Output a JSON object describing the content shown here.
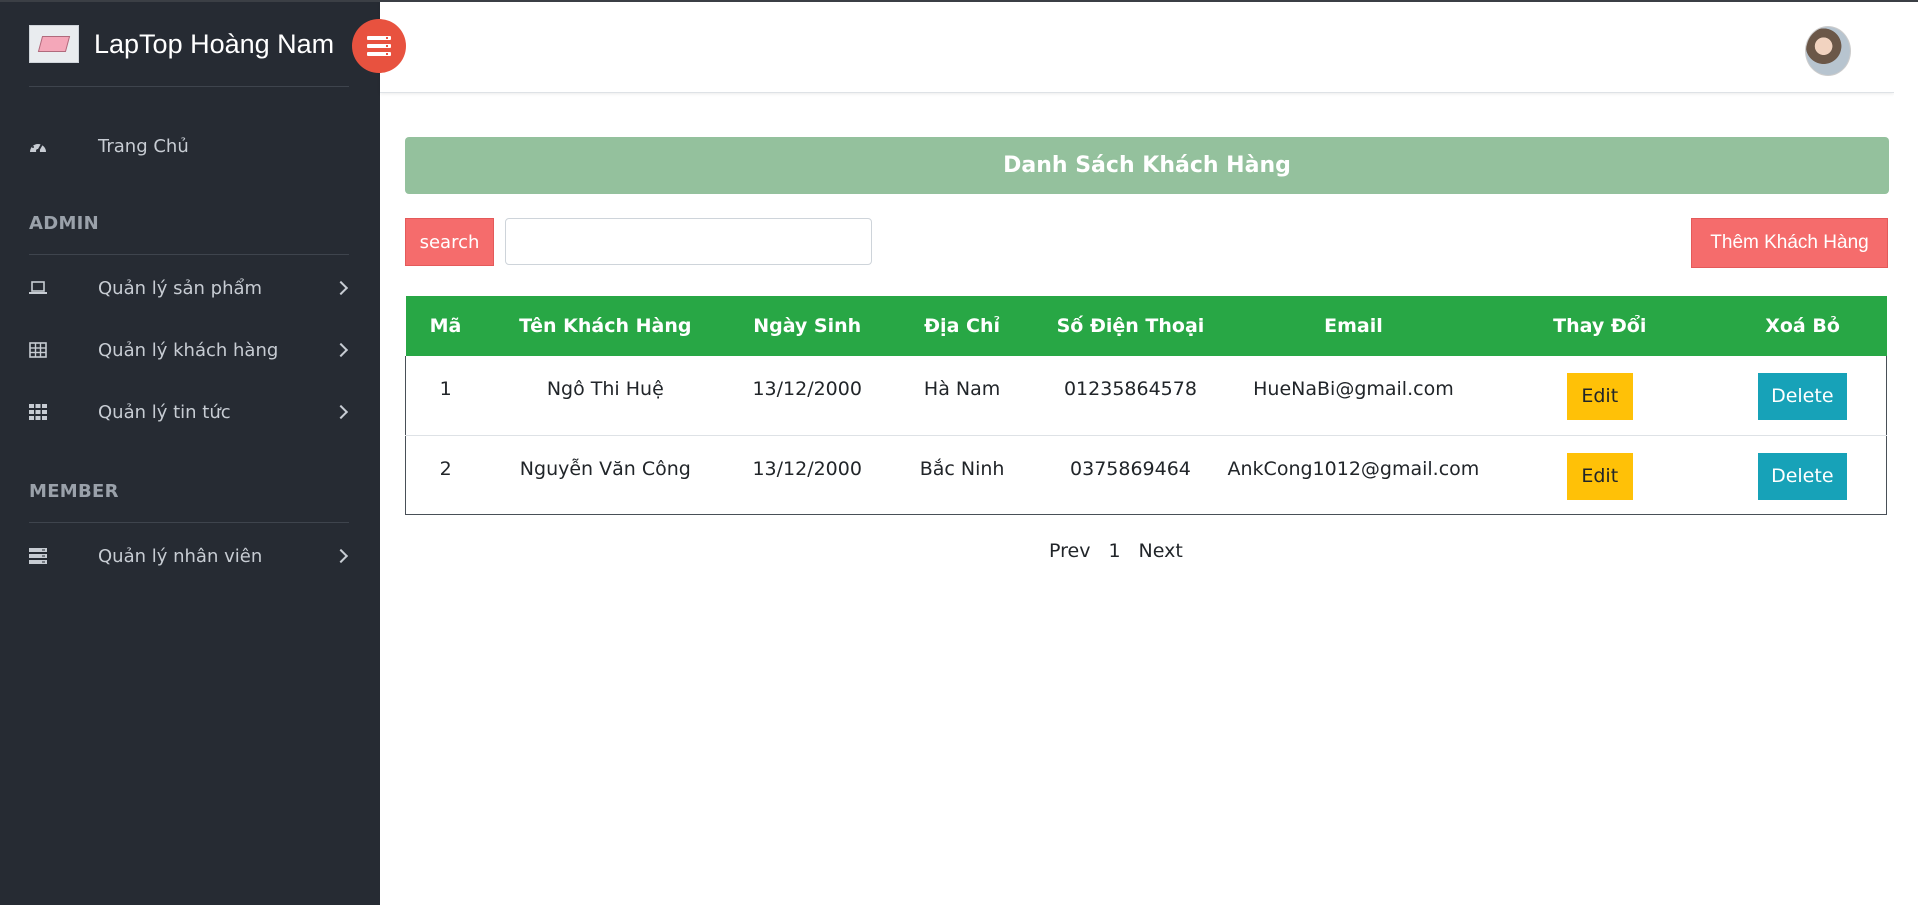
{
  "brand": {
    "name": "LapTop Hoàng Nam"
  },
  "sidebar": {
    "home": {
      "label": "Trang Chủ",
      "icon": "dashboard-icon"
    },
    "sections": [
      {
        "title": "ADMIN"
      },
      {
        "title": "MEMBER"
      }
    ],
    "items": [
      {
        "label": "Quản lý sản phẩm",
        "icon": "laptop-icon"
      },
      {
        "label": "Quản lý khách hàng",
        "icon": "table-icon"
      },
      {
        "label": "Quản lý tin tức",
        "icon": "grid-icon"
      },
      {
        "label": "Quản lý nhân viên",
        "icon": "server-icon"
      }
    ]
  },
  "header": {
    "toggle_icon": "menu-toggle-icon",
    "avatar": "user-avatar"
  },
  "main": {
    "title": "Danh Sách Khách Hàng",
    "search": {
      "button_label": "search",
      "value": "",
      "placeholder": ""
    },
    "add_button_label": "Thêm Khách Hàng",
    "table": {
      "columns": [
        "Mã",
        "Tên Khách Hàng",
        "Ngày Sinh",
        "Địa Chỉ",
        "Số Điện Thoại",
        "Email",
        "Thay Đổi",
        "Xoá Bỏ"
      ],
      "rows": [
        {
          "id": "1",
          "name": "Ngô Thi Huệ",
          "dob": "13/12/2000",
          "address": "Hà Nam",
          "phone": "01235864578",
          "email": "HueNaBi@gmail.com",
          "edit": "Edit",
          "delete": "Delete"
        },
        {
          "id": "2",
          "name": "Nguyễn Văn Công",
          "dob": "13/12/2000",
          "address": "Bắc Ninh",
          "phone": "0375869464",
          "email": "AnkCong1012@gmail.com",
          "edit": "Edit",
          "delete": "Delete"
        }
      ]
    },
    "pagination": {
      "prev": "Prev",
      "page": "1",
      "next": "Next"
    }
  },
  "colors": {
    "sidebar_bg": "#262b33",
    "title_bar": "#94c19d",
    "table_header": "#28a745",
    "action_red": "#f56c6c",
    "edit_yellow": "#ffc107",
    "delete_teal": "#17a2b8",
    "toggle_red": "#e8523f"
  }
}
